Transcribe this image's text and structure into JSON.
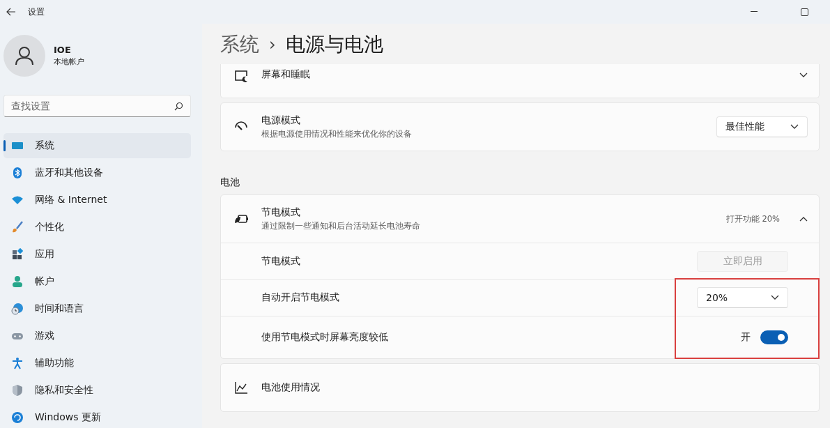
{
  "window": {
    "title": "设置"
  },
  "account": {
    "name": "IOE",
    "type": "本地帐户"
  },
  "search": {
    "placeholder": "查找设置"
  },
  "sidebar": {
    "items": [
      {
        "label": "系统",
        "selected": true
      },
      {
        "label": "蓝牙和其他设备",
        "selected": false
      },
      {
        "label": "网络 & Internet",
        "selected": false
      },
      {
        "label": "个性化",
        "selected": false
      },
      {
        "label": "应用",
        "selected": false
      },
      {
        "label": "帐户",
        "selected": false
      },
      {
        "label": "时间和语言",
        "selected": false
      },
      {
        "label": "游戏",
        "selected": false
      },
      {
        "label": "辅助功能",
        "selected": false
      },
      {
        "label": "隐私和安全性",
        "selected": false
      },
      {
        "label": "Windows 更新",
        "selected": false
      }
    ]
  },
  "breadcrumb": {
    "parent": "系统",
    "separator": "›",
    "current": "电源与电池"
  },
  "cards": [
    {
      "kind": "expander",
      "title": "屏幕和睡眠",
      "expanded": false
    },
    {
      "kind": "dropdown",
      "title": "电源模式",
      "description": "根据电源使用情况和性能来优化你的设备",
      "value": "最佳性能"
    }
  ],
  "battery_section": {
    "heading": "电池",
    "cards": [
      {
        "kind": "expander",
        "title": "节电模式",
        "description": "通过限制一些通知和后台活动延长电池寿命",
        "status": "打开功能 20%",
        "expanded": true,
        "rows": [
          {
            "kind": "button",
            "label": "节电模式",
            "button": "立即启用",
            "disabled": true,
            "highlighted": false
          },
          {
            "kind": "dropdown",
            "label": "自动开启节电模式",
            "value": "20%",
            "highlighted": true
          },
          {
            "kind": "toggle",
            "label": "使用节电模式时屏幕亮度较低",
            "state_label": "开",
            "on": true,
            "highlighted": true
          }
        ]
      },
      {
        "kind": "plain",
        "title": "电池使用情况"
      }
    ]
  }
}
